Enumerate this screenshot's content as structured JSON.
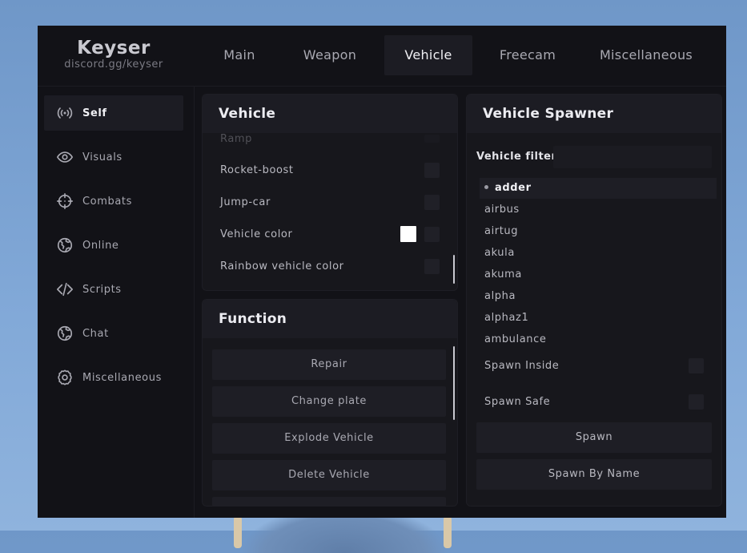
{
  "brand": {
    "title": "Keyser",
    "subtitle": "discord.gg/keyser"
  },
  "tabs": [
    {
      "label": "Main"
    },
    {
      "label": "Weapon"
    },
    {
      "label": "Vehicle",
      "active": true
    },
    {
      "label": "Freecam"
    },
    {
      "label": "Miscellaneous"
    }
  ],
  "sidebar": {
    "items": [
      {
        "label": "Self",
        "icon": "broadcast-icon",
        "active": true
      },
      {
        "label": "Visuals",
        "icon": "eye-icon"
      },
      {
        "label": "Combats",
        "icon": "crosshair-icon"
      },
      {
        "label": "Online",
        "icon": "globe-icon"
      },
      {
        "label": "Scripts",
        "icon": "code-icon"
      },
      {
        "label": "Chat",
        "icon": "globe-icon"
      },
      {
        "label": "Miscellaneous",
        "icon": "gear-icon"
      }
    ]
  },
  "vehicle_panel": {
    "title": "Vehicle",
    "options": [
      {
        "label": "Ramp"
      },
      {
        "label": "Rocket-boost"
      },
      {
        "label": "Jump-car"
      },
      {
        "label": "Vehicle color",
        "color": "#ffffff"
      },
      {
        "label": "Rainbow vehicle color"
      }
    ]
  },
  "function_panel": {
    "title": "Function",
    "buttons": [
      {
        "label": "Repair"
      },
      {
        "label": "Change plate"
      },
      {
        "label": "Explode Vehicle"
      },
      {
        "label": "Delete Vehicle"
      }
    ]
  },
  "spawner_panel": {
    "title": "Vehicle Spawner",
    "filter_label": "Vehicle filter",
    "filter_value": "",
    "vehicles": [
      "adder",
      "airbus",
      "airtug",
      "akula",
      "akuma",
      "alpha",
      "alphaz1",
      "ambulance"
    ],
    "selected": "adder",
    "options": [
      {
        "label": "Spawn Inside"
      },
      {
        "label": "Spawn Safe"
      }
    ],
    "buttons": [
      {
        "label": "Spawn"
      },
      {
        "label": "Spawn By Name"
      }
    ]
  },
  "colors": {
    "panel_bg": "#17171c",
    "header_bg": "#1c1c23",
    "window_bg": "#121217",
    "accent": "#f0f0f4"
  }
}
